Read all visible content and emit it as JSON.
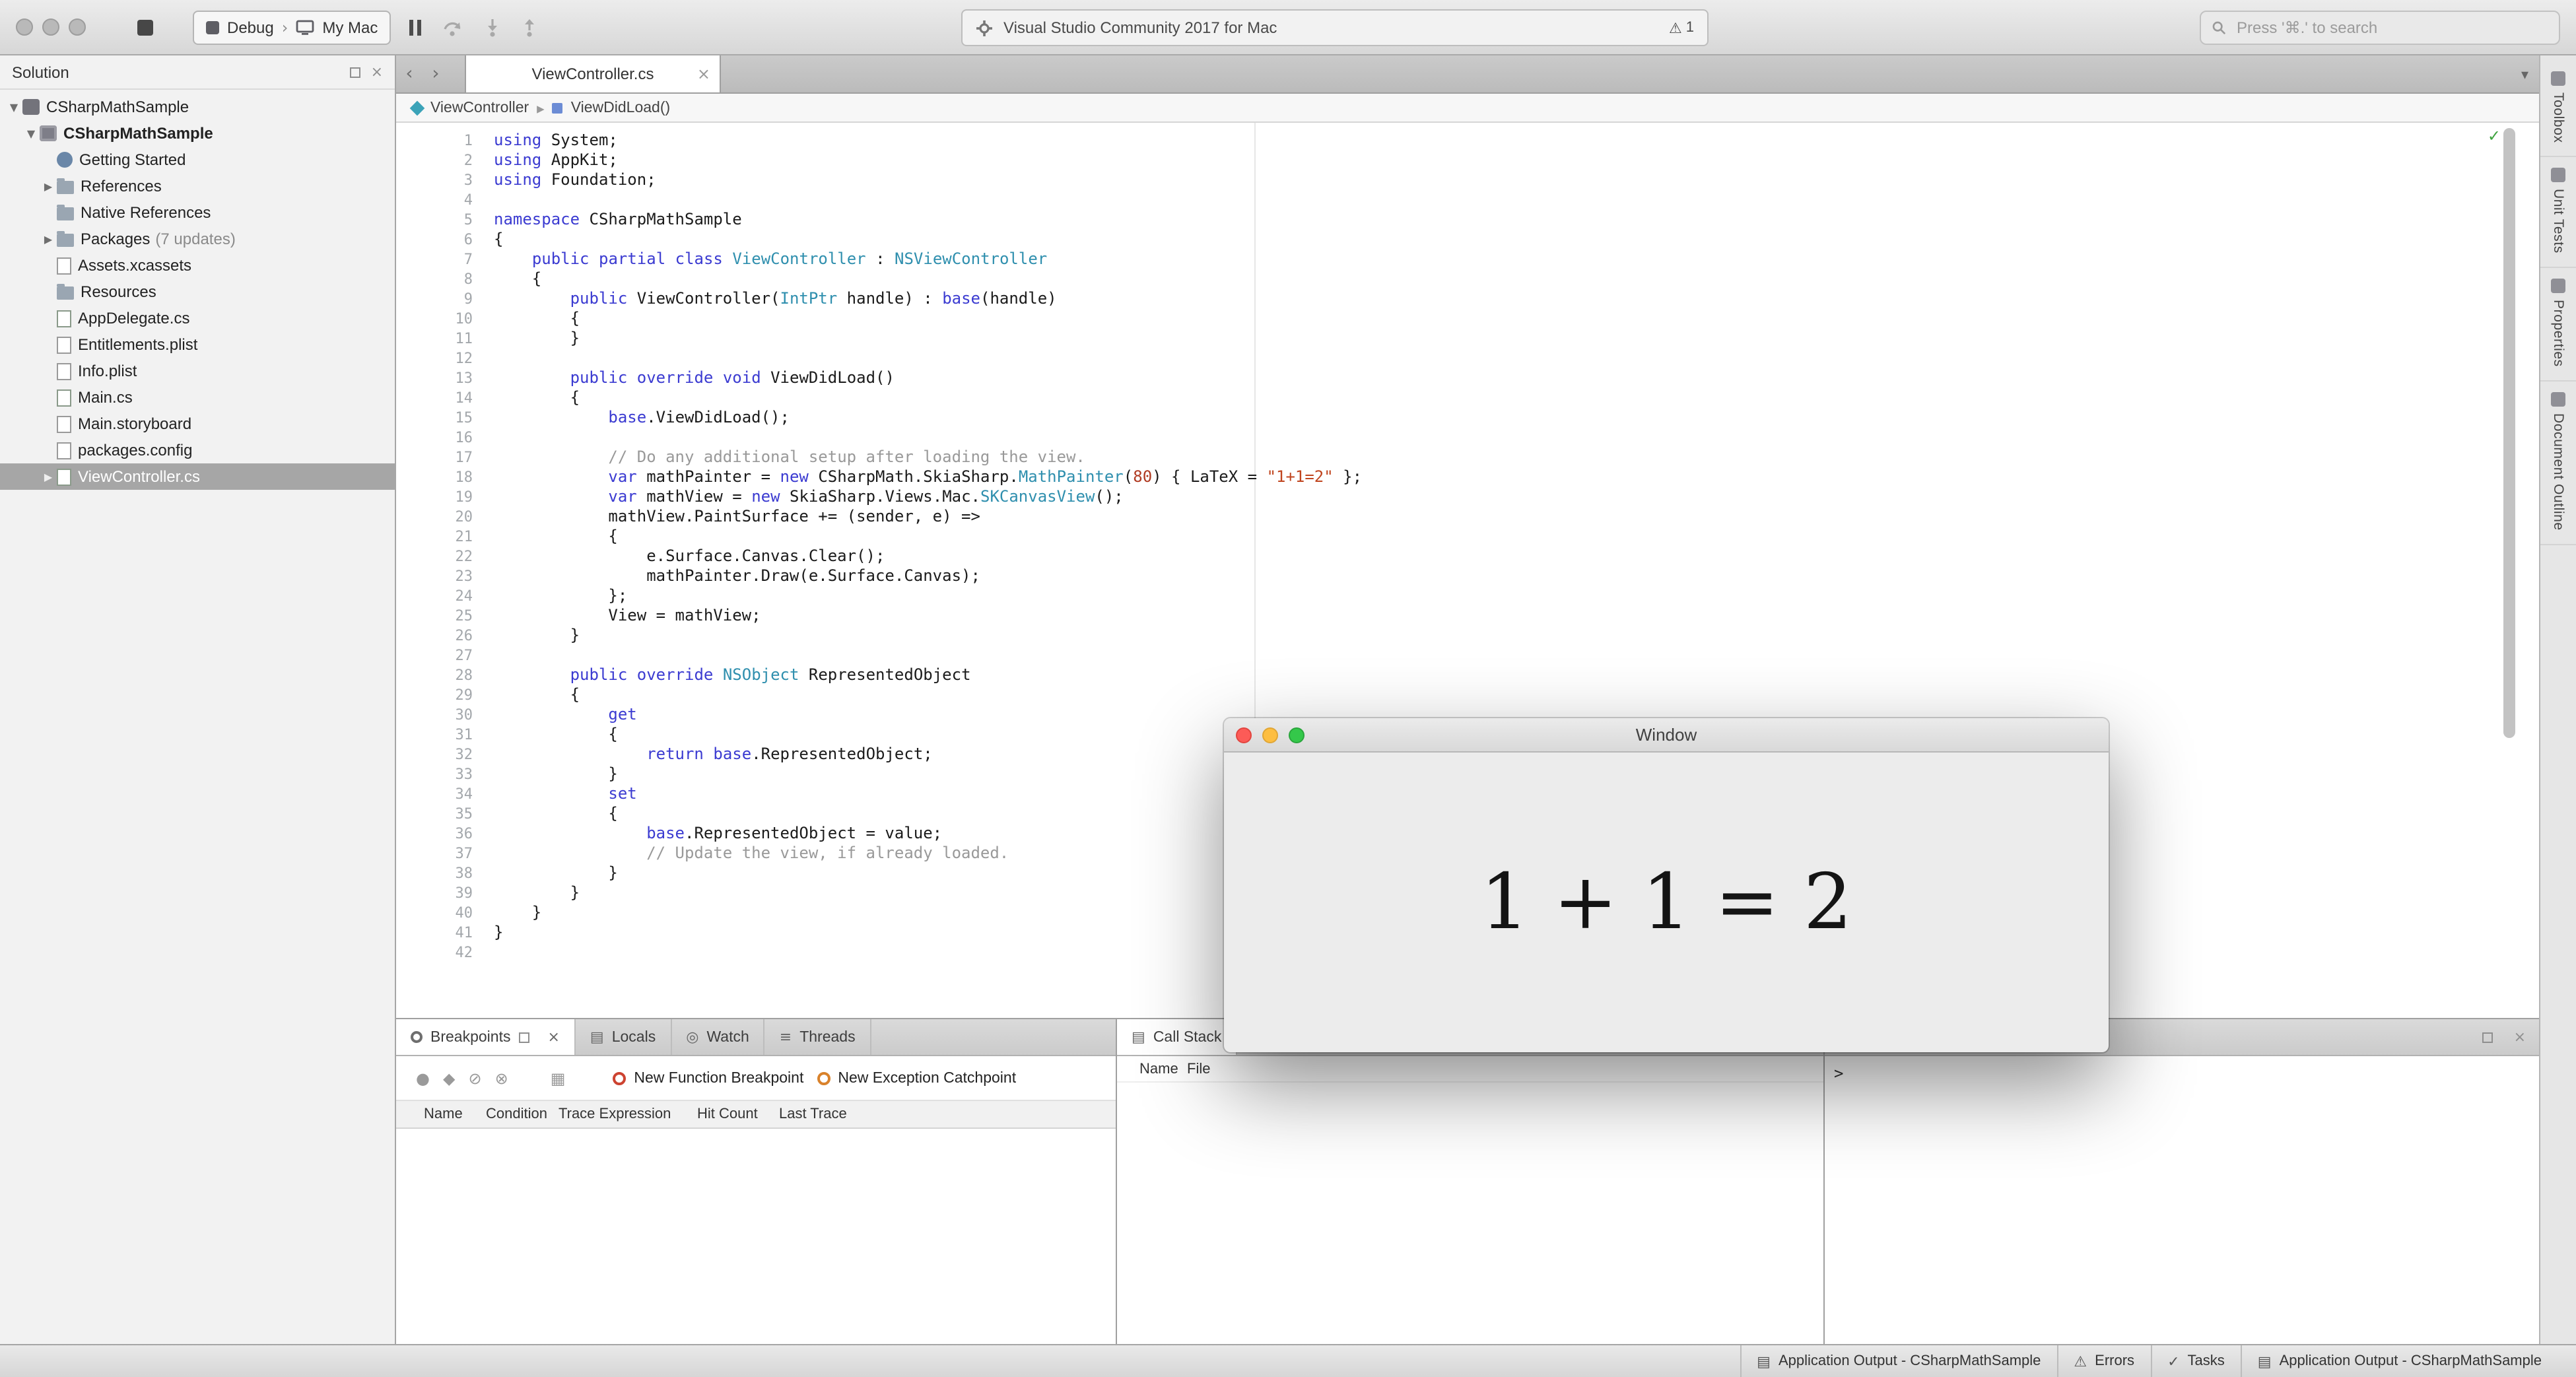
{
  "toolbar": {
    "configuration": "Debug",
    "device": "My Mac",
    "status_title": "Visual Studio Community 2017 for Mac",
    "warning_count": "1",
    "search_placeholder": "Press '⌘.' to search"
  },
  "solution_pad": {
    "title": "Solution",
    "tree": [
      {
        "label": "CSharpMathSample",
        "indent": 0,
        "arrow": "down",
        "icon": "solution"
      },
      {
        "label": "CSharpMathSample",
        "indent": 1,
        "arrow": "down",
        "icon": "project",
        "bold": true
      },
      {
        "label": "Getting Started",
        "indent": 2,
        "icon": "getting-started"
      },
      {
        "label": "References",
        "indent": 2,
        "arrow": "right",
        "icon": "folder"
      },
      {
        "label": "Native References",
        "indent": 2,
        "icon": "folder"
      },
      {
        "label": "Packages",
        "suffix": "(7 updates)",
        "indent": 2,
        "arrow": "right",
        "icon": "folder"
      },
      {
        "label": "Assets.xcassets",
        "indent": 2,
        "icon": "file"
      },
      {
        "label": "Resources",
        "indent": 2,
        "icon": "folder"
      },
      {
        "label": "AppDelegate.cs",
        "indent": 2,
        "icon": "file-cs"
      },
      {
        "label": "Entitlements.plist",
        "indent": 2,
        "icon": "file"
      },
      {
        "label": "Info.plist",
        "indent": 2,
        "icon": "file"
      },
      {
        "label": "Main.cs",
        "indent": 2,
        "icon": "file-cs"
      },
      {
        "label": "Main.storyboard",
        "indent": 2,
        "icon": "file"
      },
      {
        "label": "packages.config",
        "indent": 2,
        "icon": "file"
      },
      {
        "label": "ViewController.cs",
        "indent": 2,
        "arrow": "right",
        "icon": "file-cs",
        "selected": true
      }
    ]
  },
  "editor": {
    "tab": "ViewController.cs",
    "breadcrumb": [
      "ViewController",
      "ViewDidLoad()"
    ],
    "lines": [
      [
        [
          "k",
          "using"
        ],
        [
          "p",
          " System;"
        ]
      ],
      [
        [
          "k",
          "using"
        ],
        [
          "p",
          " AppKit;"
        ]
      ],
      [
        [
          "k",
          "using"
        ],
        [
          "p",
          " Foundation;"
        ]
      ],
      [],
      [
        [
          "k",
          "namespace"
        ],
        [
          "p",
          " CSharpMathSample"
        ]
      ],
      [
        [
          "p",
          "{"
        ]
      ],
      [
        [
          "p",
          "    "
        ],
        [
          "k",
          "public"
        ],
        [
          "p",
          " "
        ],
        [
          "k",
          "partial"
        ],
        [
          "p",
          " "
        ],
        [
          "k",
          "class"
        ],
        [
          "p",
          " "
        ],
        [
          "t",
          "ViewController"
        ],
        [
          "p",
          " : "
        ],
        [
          "t",
          "NSViewController"
        ]
      ],
      [
        [
          "p",
          "    {"
        ]
      ],
      [
        [
          "p",
          "        "
        ],
        [
          "k",
          "public"
        ],
        [
          "p",
          " ViewController("
        ],
        [
          "t",
          "IntPtr"
        ],
        [
          "p",
          " handle) : "
        ],
        [
          "k",
          "base"
        ],
        [
          "p",
          "(handle)"
        ]
      ],
      [
        [
          "p",
          "        {"
        ]
      ],
      [
        [
          "p",
          "        }"
        ]
      ],
      [],
      [
        [
          "p",
          "        "
        ],
        [
          "k",
          "public"
        ],
        [
          "p",
          " "
        ],
        [
          "k",
          "override"
        ],
        [
          "p",
          " "
        ],
        [
          "k",
          "void"
        ],
        [
          "p",
          " ViewDidLoad()"
        ]
      ],
      [
        [
          "p",
          "        {"
        ]
      ],
      [
        [
          "p",
          "            "
        ],
        [
          "k",
          "base"
        ],
        [
          "p",
          ".ViewDidLoad();"
        ]
      ],
      [],
      [
        [
          "p",
          "            "
        ],
        [
          "c",
          "// Do any additional setup after loading the view."
        ]
      ],
      [
        [
          "p",
          "            "
        ],
        [
          "k",
          "var"
        ],
        [
          "p",
          " mathPainter = "
        ],
        [
          "k",
          "new"
        ],
        [
          "p",
          " CSharpMath.SkiaSharp."
        ],
        [
          "t",
          "MathPainter"
        ],
        [
          "p",
          "("
        ],
        [
          "n",
          "80"
        ],
        [
          "p",
          ") { LaTeX = "
        ],
        [
          "s",
          "\"1+1=2\""
        ],
        [
          "p",
          " };"
        ]
      ],
      [
        [
          "p",
          "            "
        ],
        [
          "k",
          "var"
        ],
        [
          "p",
          " mathView = "
        ],
        [
          "k",
          "new"
        ],
        [
          "p",
          " SkiaSharp.Views.Mac."
        ],
        [
          "t",
          "SKCanvasView"
        ],
        [
          "p",
          "();"
        ]
      ],
      [
        [
          "p",
          "            mathView.PaintSurface += (sender, e) =>"
        ]
      ],
      [
        [
          "p",
          "            {"
        ]
      ],
      [
        [
          "p",
          "                e.Surface.Canvas.Clear();"
        ]
      ],
      [
        [
          "p",
          "                mathPainter.Draw(e.Surface.Canvas);"
        ]
      ],
      [
        [
          "p",
          "            };"
        ]
      ],
      [
        [
          "p",
          "            View = mathView;"
        ]
      ],
      [
        [
          "p",
          "        }"
        ]
      ],
      [],
      [
        [
          "p",
          "        "
        ],
        [
          "k",
          "public"
        ],
        [
          "p",
          " "
        ],
        [
          "k",
          "override"
        ],
        [
          "p",
          " "
        ],
        [
          "t",
          "NSObject"
        ],
        [
          "p",
          " RepresentedObject"
        ]
      ],
      [
        [
          "p",
          "        {"
        ]
      ],
      [
        [
          "p",
          "            "
        ],
        [
          "k",
          "get"
        ]
      ],
      [
        [
          "p",
          "            {"
        ]
      ],
      [
        [
          "p",
          "                "
        ],
        [
          "k",
          "return"
        ],
        [
          "p",
          " "
        ],
        [
          "k",
          "base"
        ],
        [
          "p",
          ".RepresentedObject;"
        ]
      ],
      [
        [
          "p",
          "            }"
        ]
      ],
      [
        [
          "p",
          "            "
        ],
        [
          "k",
          "set"
        ]
      ],
      [
        [
          "p",
          "            {"
        ]
      ],
      [
        [
          "p",
          "                "
        ],
        [
          "k",
          "base"
        ],
        [
          "p",
          ".RepresentedObject = value;"
        ]
      ],
      [
        [
          "p",
          "                "
        ],
        [
          "c",
          "// Update the view, if already loaded."
        ]
      ],
      [
        [
          "p",
          "            }"
        ]
      ],
      [
        [
          "p",
          "        }"
        ]
      ],
      [
        [
          "p",
          "    }"
        ]
      ],
      [
        [
          "p",
          "}"
        ]
      ],
      []
    ]
  },
  "breakpoints_pad": {
    "tabs": [
      {
        "label": "Breakpoints",
        "active": true
      },
      {
        "label": "Locals"
      },
      {
        "label": "Watch"
      },
      {
        "label": "Threads"
      }
    ],
    "buttons": [
      "New Function Breakpoint",
      "New Exception Catchpoint"
    ],
    "columns": [
      "Name",
      "Condition",
      "Trace Expression",
      "Hit Count",
      "Last Trace"
    ]
  },
  "callstack_pad": {
    "title": "Call Stack",
    "columns": [
      "Name",
      "File"
    ]
  },
  "immediate_pad": {
    "prompt": ">"
  },
  "right_strip": {
    "tabs": [
      "Toolbox",
      "Unit Tests",
      "Properties",
      "Document Outline"
    ]
  },
  "status_bar": {
    "items": [
      {
        "label": "Application Output - CSharpMathSample",
        "icon": "output"
      },
      {
        "label": "Errors",
        "icon": "errors"
      },
      {
        "label": "Tasks",
        "icon": "tasks"
      },
      {
        "label": "Application Output - CSharpMathSample",
        "icon": "output"
      }
    ]
  },
  "float_window": {
    "title": "Window",
    "math_display": "1 + 1 = 2"
  },
  "icons": {
    "chevron_back": "‹",
    "chevron_forward": "›",
    "close": "×",
    "tab_overflow": "▾",
    "breadcrumb_separator": "▸",
    "warning": "⚠",
    "check": "✓",
    "expander_expanded": "▼",
    "expander_collapsed": "▶",
    "new_breakpoint": "●",
    "edit_breakpoint": "◆",
    "disable_breakpoints": "⊘",
    "remove_breakpoints": "⊗",
    "columns": "▦",
    "locals": "▤",
    "watch": "◎",
    "threads": "≡",
    "call_stack": "▤",
    "output": "▤",
    "errors": "⚠",
    "tasks": "✓"
  },
  "colors": {
    "keyword": "#3b3bd1",
    "type": "#2f8fae",
    "string": "#c0451f",
    "number": "#b03a21",
    "comment": "#999999",
    "traffic_red": "#fc5b57",
    "traffic_yellow": "#fdbe41",
    "traffic_green": "#34c84a"
  }
}
